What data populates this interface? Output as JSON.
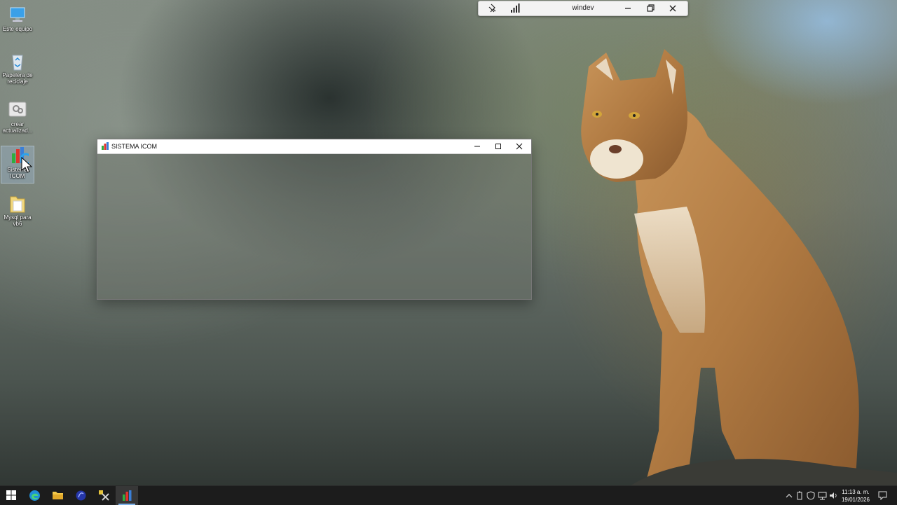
{
  "desktop": {
    "icons": [
      {
        "label": "Este equipo",
        "icon": "computer-icon"
      },
      {
        "label": "Papelera de reciclaje",
        "icon": "recycle-bin-icon"
      },
      {
        "label": "crear actualizad...",
        "icon": "shortcut-app-icon"
      },
      {
        "label": "Sistema ICOM",
        "icon": "sistema-icom-icon"
      },
      {
        "label": "Mysql para vb6",
        "icon": "folder-icon"
      }
    ]
  },
  "remote_bar": {
    "title": "windev",
    "buttons": [
      "pin-icon",
      "signal-icon",
      "minimize-icon",
      "restore-icon",
      "close-icon"
    ]
  },
  "window": {
    "title": "SISTEMA ICOM",
    "buttons": [
      "minimize-icon",
      "maximize-icon",
      "close-icon"
    ]
  },
  "taskbar": {
    "items": [
      "start-icon",
      "edge-icon",
      "file-explorer-icon",
      "vb-ide-icon",
      "tools-icon",
      "sistema-icom-icon"
    ],
    "active_item": "sistema-icom-icon",
    "tray": [
      "chevron-up-icon",
      "battery-icon",
      "shield-icon",
      "network-icon",
      "volume-icon"
    ],
    "clock": {
      "time": "11:13 a. m.",
      "date": "19/01/2026"
    },
    "notification": "notification-icon"
  },
  "colors": {
    "accent": "#7fb3ea",
    "taskbar_bg": "#1c1c1c",
    "titlebar_bg": "#ffffff"
  }
}
